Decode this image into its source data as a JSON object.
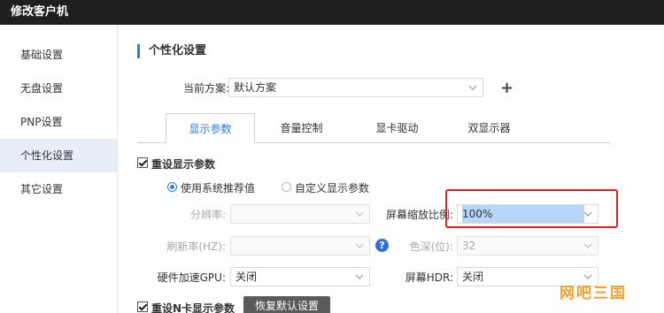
{
  "window": {
    "title": "修改客户机"
  },
  "sidebar": {
    "items": [
      {
        "label": "基础设置"
      },
      {
        "label": "无盘设置"
      },
      {
        "label": "PNP设置"
      },
      {
        "label": "个性化设置"
      },
      {
        "label": "其它设置"
      }
    ]
  },
  "main": {
    "section_title": "个性化设置",
    "scheme": {
      "label": "当前方案:",
      "value": "默认方案"
    },
    "tabs": [
      {
        "label": "显示参数"
      },
      {
        "label": "音量控制"
      },
      {
        "label": "显卡驱动"
      },
      {
        "label": "双显示器"
      }
    ],
    "reset_display": {
      "label": "重设显示参数"
    },
    "radio_system": {
      "label": "使用系统推荐值"
    },
    "radio_custom": {
      "label": "自定义显示参数"
    },
    "resolution": {
      "label": "分辨率:",
      "value": ""
    },
    "scale": {
      "label": "屏幕缩放比例:",
      "value": "100%"
    },
    "refresh": {
      "label": "刷新率(HZ):",
      "value": ""
    },
    "help_icon": "?",
    "color_depth": {
      "label": "色深(位):",
      "value": "32"
    },
    "gpu_accel": {
      "label": "硬件加速GPU:",
      "value": "关闭"
    },
    "hdr": {
      "label": "屏幕HDR:",
      "value": "关闭"
    },
    "reset_n": {
      "label": "重设N卡显示参数"
    },
    "restore_button": "恢复默认设置"
  },
  "watermark": "网吧三国",
  "colors": {
    "accent": "#2f7bd6",
    "highlight_border": "#e02020",
    "titlebar": "#1f1f1f"
  }
}
